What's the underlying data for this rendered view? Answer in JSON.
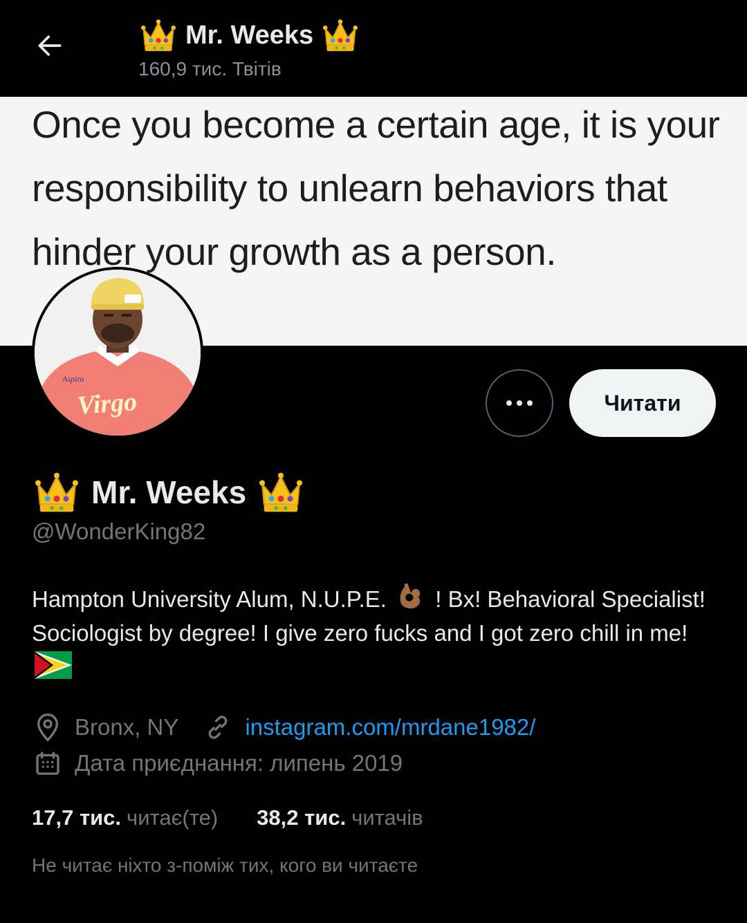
{
  "header": {
    "name": "Mr. Weeks",
    "tweet_count": "160,9 тис. Твітів",
    "back_icon": "arrow-left-icon"
  },
  "banner": {
    "quote_text": "Once you become a certain age, it is your responsibility to unlearn behaviors that hinder your growth as a person."
  },
  "avatar": {
    "shirt_text": "Virgo"
  },
  "actions": {
    "more_icon": "more-dots-icon",
    "follow_label": "Читати"
  },
  "profile": {
    "name": "Mr. Weeks",
    "handle": "@WonderKing82",
    "bio_part1": "Hampton University Alum, N.U.P.E.",
    "bio_part2": "! Bx! Behavioral Specialist! Sociologist by degree! I give zero fucks and I got zero chill in me!",
    "location": "Bronx, NY",
    "website": "instagram.com/mrdane1982/",
    "joined": "Дата приєднання: липень 2019"
  },
  "stats": {
    "following_count": "17,7 тис.",
    "following_label": "читає(те)",
    "followers_count": "38,2 тис.",
    "followers_label": "читачів"
  },
  "note": "Не читає ніхто з-поміж тих, кого ви читаєте",
  "colors": {
    "background": "#000000",
    "link": "#1d9bf0",
    "muted": "#71767b",
    "button_bg": "#eff3f4"
  }
}
